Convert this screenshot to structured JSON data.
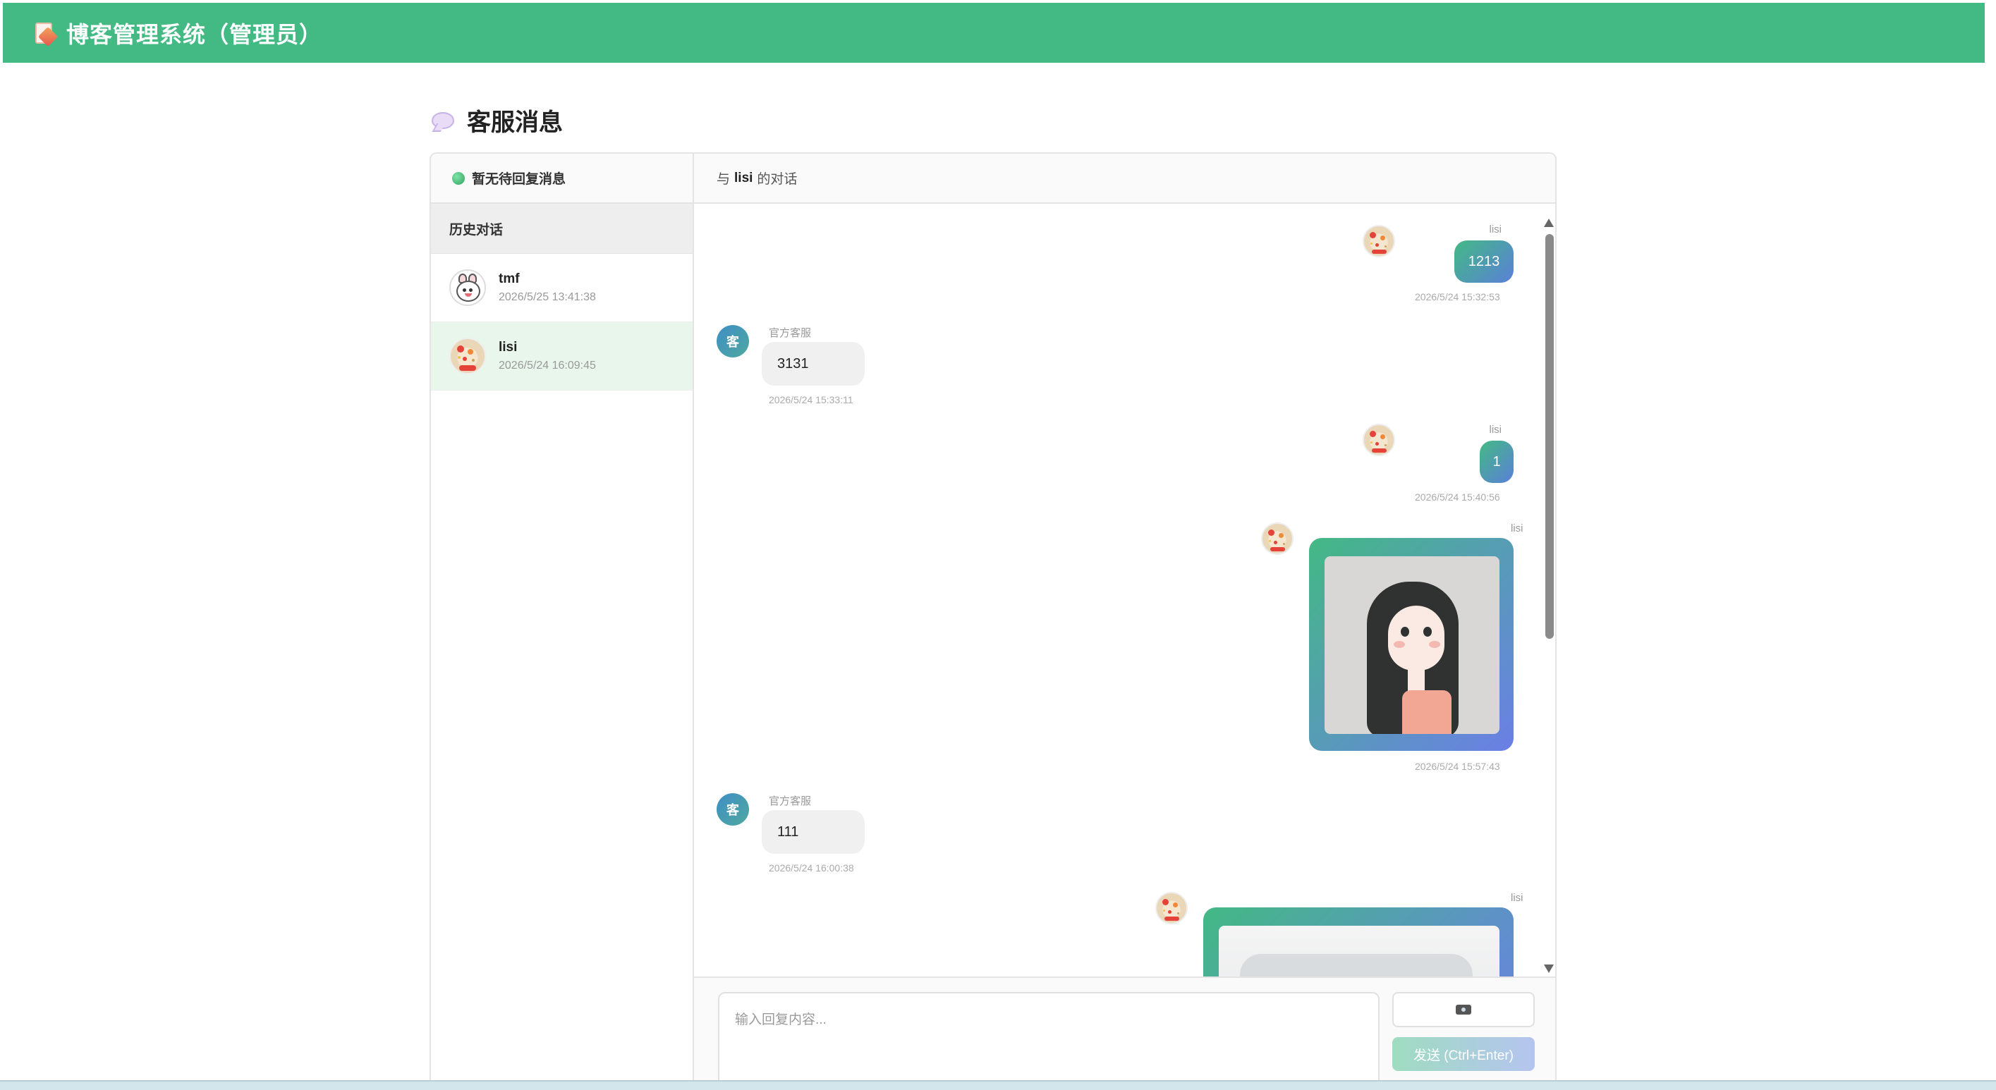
{
  "app": {
    "title": "博客管理系统（管理员）"
  },
  "page": {
    "title": "客服消息"
  },
  "sidebar": {
    "pending_text": "暂无待回复消息",
    "history_label": "历史对话",
    "conversations": [
      {
        "name": "tmf",
        "time": "2026/5/25 13:41:38",
        "active": false
      },
      {
        "name": "lisi",
        "time": "2026/5/24 16:09:45",
        "active": true
      }
    ]
  },
  "chat": {
    "header_prefix": "与",
    "header_user": "lisi",
    "header_suffix": "的对话",
    "messages": [
      {
        "from": "user",
        "sender": "lisi",
        "text": "1213",
        "time": "2026/5/24 15:32:53"
      },
      {
        "from": "admin",
        "sender": "官方客服",
        "avatar_text": "客",
        "text": "3131",
        "time": "2026/5/24 15:33:11"
      },
      {
        "from": "user",
        "sender": "lisi",
        "text": "1",
        "time": "2026/5/24 15:40:56"
      },
      {
        "from": "user",
        "sender": "lisi",
        "type": "image",
        "time": "2026/5/24 15:57:43"
      },
      {
        "from": "admin",
        "sender": "官方客服",
        "avatar_text": "客",
        "text": "111",
        "time": "2026/5/24 16:00:38"
      },
      {
        "from": "user",
        "sender": "lisi",
        "type": "image"
      }
    ]
  },
  "composer": {
    "placeholder": "输入回复内容...",
    "image_button_icon": "camera-icon",
    "send_label": "发送 (Ctrl+Enter)"
  },
  "colors": {
    "topbar": "#43b984",
    "user_bubble_start": "#43b984",
    "user_bubble_end": "#5a80d8",
    "active_item": "#e9f6ec"
  }
}
